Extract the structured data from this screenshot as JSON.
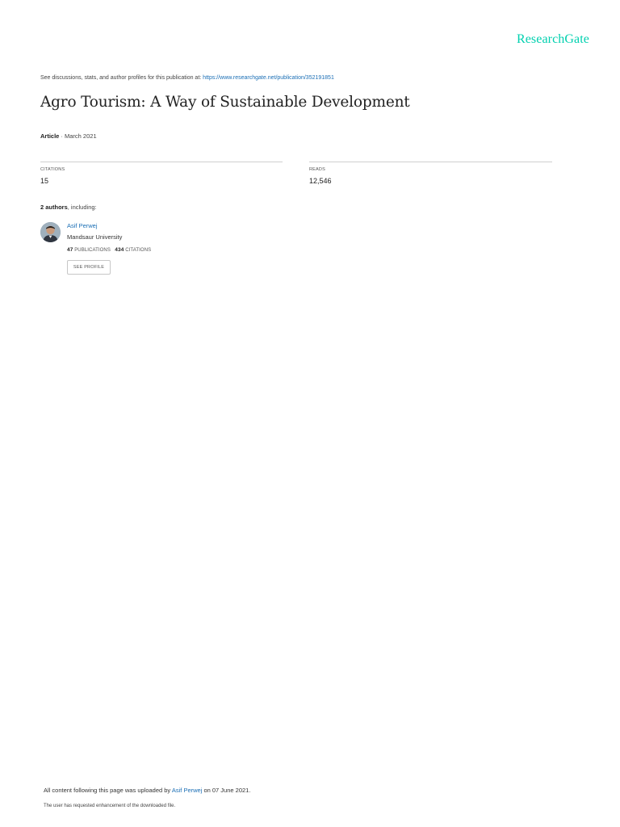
{
  "brand": {
    "name": "ResearchGate",
    "color": "#00d0af"
  },
  "header": {
    "discussion_text": "See discussions, stats, and author profiles for this publication at: ",
    "publication_url": "https://www.researchgate.net/publication/352191851"
  },
  "publication": {
    "title": "Agro Tourism: A Way of Sustainable Development",
    "type": "Article",
    "date": " · March 2021"
  },
  "stats": {
    "citations_label": "CITATIONS",
    "citations_value": "15",
    "reads_label": "READS",
    "reads_value": "12,546"
  },
  "authors": {
    "count_label": "2 authors",
    "suffix": ", including:",
    "list": [
      {
        "name": "Asif Perwej",
        "affiliation": "Mandsaur University",
        "publications_count": "47",
        "publications_label": " PUBLICATIONS",
        "citations_count": "434",
        "citations_label": " CITATIONS",
        "see_profile_label": "SEE PROFILE"
      }
    ]
  },
  "footer": {
    "upload_prefix": "All content following this page was uploaded by ",
    "uploader": "Asif Perwej",
    "upload_suffix": " on 07 June 2021.",
    "enhancement_note": "The user has requested enhancement of the downloaded file."
  },
  "colors": {
    "link": "#1a6eb5",
    "text": "#333333",
    "rule": "#cfcfcf"
  }
}
